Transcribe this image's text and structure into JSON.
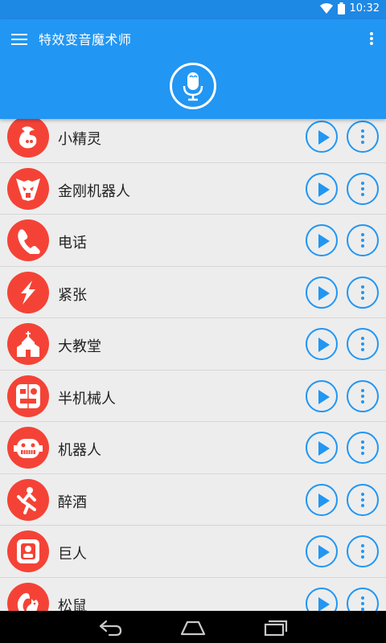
{
  "status": {
    "time": "10:32"
  },
  "app": {
    "title": "特效变音魔术师"
  },
  "items": [
    {
      "label": "小精灵"
    },
    {
      "label": "金刚机器人"
    },
    {
      "label": "电话"
    },
    {
      "label": "紧张"
    },
    {
      "label": "大教堂"
    },
    {
      "label": "半机械人"
    },
    {
      "label": "机器人"
    },
    {
      "label": "醉酒"
    },
    {
      "label": "巨人"
    },
    {
      "label": "松鼠"
    }
  ],
  "icons": {
    "wifi": "wifi-icon",
    "battery": "battery-icon",
    "menu": "menu-icon",
    "overflow": "overflow-menu-icon",
    "mic": "microphone-icon",
    "play": "play-icon",
    "more": "more-vertical-icon",
    "back": "back-icon",
    "home": "home-icon",
    "recents": "recents-icon"
  },
  "colors": {
    "primary": "#2196F3",
    "status": "#1E88E5",
    "avatar": "#F44336",
    "background": "#ECECEC"
  }
}
